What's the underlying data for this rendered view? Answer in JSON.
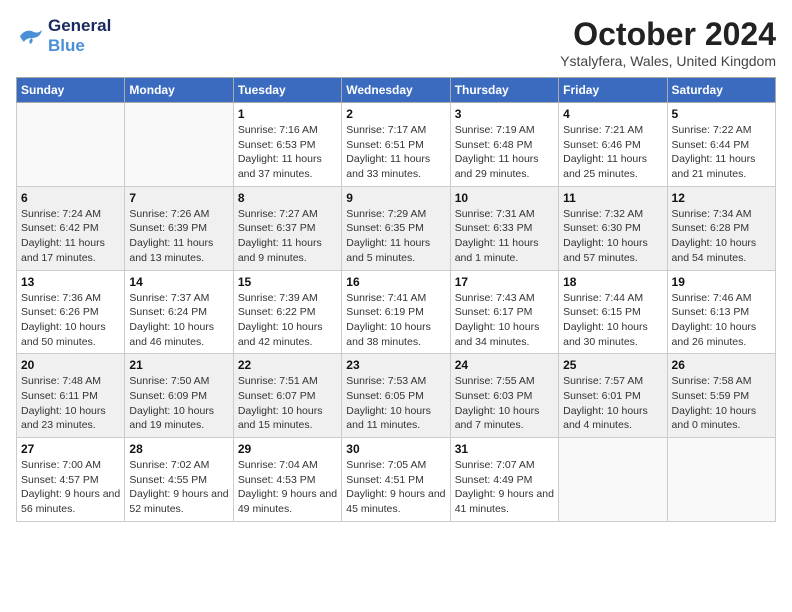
{
  "header": {
    "logo_line1": "General",
    "logo_line2": "Blue",
    "month_title": "October 2024",
    "location": "Ystalyfera, Wales, United Kingdom"
  },
  "weekdays": [
    "Sunday",
    "Monday",
    "Tuesday",
    "Wednesday",
    "Thursday",
    "Friday",
    "Saturday"
  ],
  "weeks": [
    [
      {
        "day": "",
        "sunrise": "",
        "sunset": "",
        "daylight": ""
      },
      {
        "day": "",
        "sunrise": "",
        "sunset": "",
        "daylight": ""
      },
      {
        "day": "1",
        "sunrise": "Sunrise: 7:16 AM",
        "sunset": "Sunset: 6:53 PM",
        "daylight": "Daylight: 11 hours and 37 minutes."
      },
      {
        "day": "2",
        "sunrise": "Sunrise: 7:17 AM",
        "sunset": "Sunset: 6:51 PM",
        "daylight": "Daylight: 11 hours and 33 minutes."
      },
      {
        "day": "3",
        "sunrise": "Sunrise: 7:19 AM",
        "sunset": "Sunset: 6:48 PM",
        "daylight": "Daylight: 11 hours and 29 minutes."
      },
      {
        "day": "4",
        "sunrise": "Sunrise: 7:21 AM",
        "sunset": "Sunset: 6:46 PM",
        "daylight": "Daylight: 11 hours and 25 minutes."
      },
      {
        "day": "5",
        "sunrise": "Sunrise: 7:22 AM",
        "sunset": "Sunset: 6:44 PM",
        "daylight": "Daylight: 11 hours and 21 minutes."
      }
    ],
    [
      {
        "day": "6",
        "sunrise": "Sunrise: 7:24 AM",
        "sunset": "Sunset: 6:42 PM",
        "daylight": "Daylight: 11 hours and 17 minutes."
      },
      {
        "day": "7",
        "sunrise": "Sunrise: 7:26 AM",
        "sunset": "Sunset: 6:39 PM",
        "daylight": "Daylight: 11 hours and 13 minutes."
      },
      {
        "day": "8",
        "sunrise": "Sunrise: 7:27 AM",
        "sunset": "Sunset: 6:37 PM",
        "daylight": "Daylight: 11 hours and 9 minutes."
      },
      {
        "day": "9",
        "sunrise": "Sunrise: 7:29 AM",
        "sunset": "Sunset: 6:35 PM",
        "daylight": "Daylight: 11 hours and 5 minutes."
      },
      {
        "day": "10",
        "sunrise": "Sunrise: 7:31 AM",
        "sunset": "Sunset: 6:33 PM",
        "daylight": "Daylight: 11 hours and 1 minute."
      },
      {
        "day": "11",
        "sunrise": "Sunrise: 7:32 AM",
        "sunset": "Sunset: 6:30 PM",
        "daylight": "Daylight: 10 hours and 57 minutes."
      },
      {
        "day": "12",
        "sunrise": "Sunrise: 7:34 AM",
        "sunset": "Sunset: 6:28 PM",
        "daylight": "Daylight: 10 hours and 54 minutes."
      }
    ],
    [
      {
        "day": "13",
        "sunrise": "Sunrise: 7:36 AM",
        "sunset": "Sunset: 6:26 PM",
        "daylight": "Daylight: 10 hours and 50 minutes."
      },
      {
        "day": "14",
        "sunrise": "Sunrise: 7:37 AM",
        "sunset": "Sunset: 6:24 PM",
        "daylight": "Daylight: 10 hours and 46 minutes."
      },
      {
        "day": "15",
        "sunrise": "Sunrise: 7:39 AM",
        "sunset": "Sunset: 6:22 PM",
        "daylight": "Daylight: 10 hours and 42 minutes."
      },
      {
        "day": "16",
        "sunrise": "Sunrise: 7:41 AM",
        "sunset": "Sunset: 6:19 PM",
        "daylight": "Daylight: 10 hours and 38 minutes."
      },
      {
        "day": "17",
        "sunrise": "Sunrise: 7:43 AM",
        "sunset": "Sunset: 6:17 PM",
        "daylight": "Daylight: 10 hours and 34 minutes."
      },
      {
        "day": "18",
        "sunrise": "Sunrise: 7:44 AM",
        "sunset": "Sunset: 6:15 PM",
        "daylight": "Daylight: 10 hours and 30 minutes."
      },
      {
        "day": "19",
        "sunrise": "Sunrise: 7:46 AM",
        "sunset": "Sunset: 6:13 PM",
        "daylight": "Daylight: 10 hours and 26 minutes."
      }
    ],
    [
      {
        "day": "20",
        "sunrise": "Sunrise: 7:48 AM",
        "sunset": "Sunset: 6:11 PM",
        "daylight": "Daylight: 10 hours and 23 minutes."
      },
      {
        "day": "21",
        "sunrise": "Sunrise: 7:50 AM",
        "sunset": "Sunset: 6:09 PM",
        "daylight": "Daylight: 10 hours and 19 minutes."
      },
      {
        "day": "22",
        "sunrise": "Sunrise: 7:51 AM",
        "sunset": "Sunset: 6:07 PM",
        "daylight": "Daylight: 10 hours and 15 minutes."
      },
      {
        "day": "23",
        "sunrise": "Sunrise: 7:53 AM",
        "sunset": "Sunset: 6:05 PM",
        "daylight": "Daylight: 10 hours and 11 minutes."
      },
      {
        "day": "24",
        "sunrise": "Sunrise: 7:55 AM",
        "sunset": "Sunset: 6:03 PM",
        "daylight": "Daylight: 10 hours and 7 minutes."
      },
      {
        "day": "25",
        "sunrise": "Sunrise: 7:57 AM",
        "sunset": "Sunset: 6:01 PM",
        "daylight": "Daylight: 10 hours and 4 minutes."
      },
      {
        "day": "26",
        "sunrise": "Sunrise: 7:58 AM",
        "sunset": "Sunset: 5:59 PM",
        "daylight": "Daylight: 10 hours and 0 minutes."
      }
    ],
    [
      {
        "day": "27",
        "sunrise": "Sunrise: 7:00 AM",
        "sunset": "Sunset: 4:57 PM",
        "daylight": "Daylight: 9 hours and 56 minutes."
      },
      {
        "day": "28",
        "sunrise": "Sunrise: 7:02 AM",
        "sunset": "Sunset: 4:55 PM",
        "daylight": "Daylight: 9 hours and 52 minutes."
      },
      {
        "day": "29",
        "sunrise": "Sunrise: 7:04 AM",
        "sunset": "Sunset: 4:53 PM",
        "daylight": "Daylight: 9 hours and 49 minutes."
      },
      {
        "day": "30",
        "sunrise": "Sunrise: 7:05 AM",
        "sunset": "Sunset: 4:51 PM",
        "daylight": "Daylight: 9 hours and 45 minutes."
      },
      {
        "day": "31",
        "sunrise": "Sunrise: 7:07 AM",
        "sunset": "Sunset: 4:49 PM",
        "daylight": "Daylight: 9 hours and 41 minutes."
      },
      {
        "day": "",
        "sunrise": "",
        "sunset": "",
        "daylight": ""
      },
      {
        "day": "",
        "sunrise": "",
        "sunset": "",
        "daylight": ""
      }
    ]
  ]
}
